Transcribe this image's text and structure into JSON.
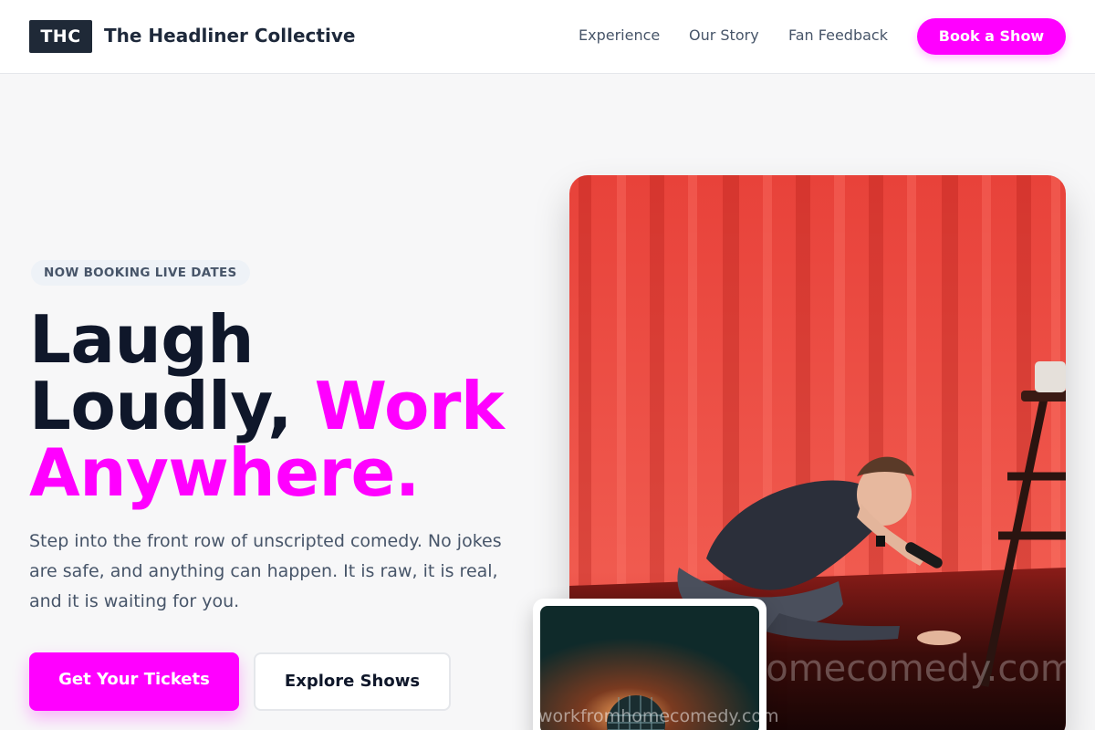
{
  "header": {
    "logo_text": "THC",
    "brand_name": "The Headliner Collective",
    "nav": [
      "Experience",
      "Our Story",
      "Fan Feedback"
    ],
    "cta_label": "Book a Show"
  },
  "hero": {
    "eyebrow": "NOW BOOKING LIVE DATES",
    "headline_line1": "Laugh",
    "headline_line2_dark": "Loudly,",
    "headline_line2_accent": "Work",
    "headline_line3_accent": "Anywhere.",
    "lede": "Step into the front row of unscripted comedy. No jokes are safe, and anything can happen. It is raw, it is real, and it is waiting for you.",
    "primary_cta": "Get Your Tickets",
    "secondary_cta": "Explore Shows"
  },
  "media": {
    "hero_watermark": "workfromhomecomedy.com",
    "inset_watermark": "workfromhomecomedy.com"
  },
  "colors": {
    "accent": "#ff00ff",
    "dark": "#0f172a",
    "muted": "#475569",
    "logo_bg": "#1f2937"
  }
}
